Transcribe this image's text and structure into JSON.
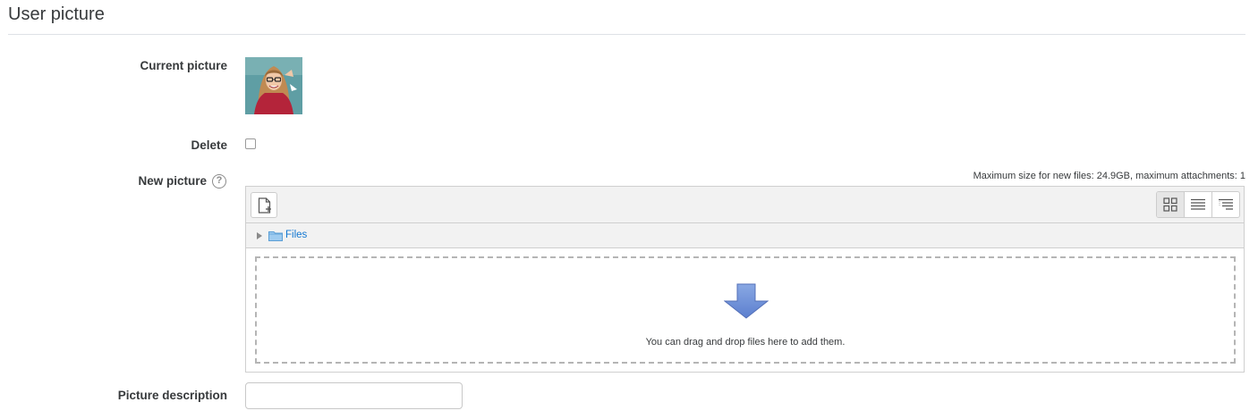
{
  "section": {
    "title": "User picture"
  },
  "current_picture": {
    "label": "Current picture",
    "avatar_icon": "user-photo"
  },
  "delete": {
    "label": "Delete",
    "checked": false
  },
  "new_picture": {
    "label": "New picture",
    "help_icon": "?",
    "limits": "Maximum size for new files: 24.9GB, maximum attachments: 1",
    "toolbar": {
      "add_file_icon": "add-file-icon",
      "views": [
        {
          "name": "icons",
          "icon": "grid-view-icon",
          "active": true
        },
        {
          "name": "list",
          "icon": "list-view-icon",
          "active": false
        },
        {
          "name": "tree",
          "icon": "tree-view-icon",
          "active": false
        }
      ]
    },
    "path": {
      "folder_label": "Files"
    },
    "dropzone_text": "You can drag and drop files here to add them."
  },
  "picture_description": {
    "label": "Picture description",
    "value": "",
    "placeholder": ""
  },
  "colors": {
    "link": "#1177d1",
    "arrow_fill": "#6f8fd4",
    "toolbar_bg": "#f2f2f2",
    "border": "#cfcfcf"
  }
}
